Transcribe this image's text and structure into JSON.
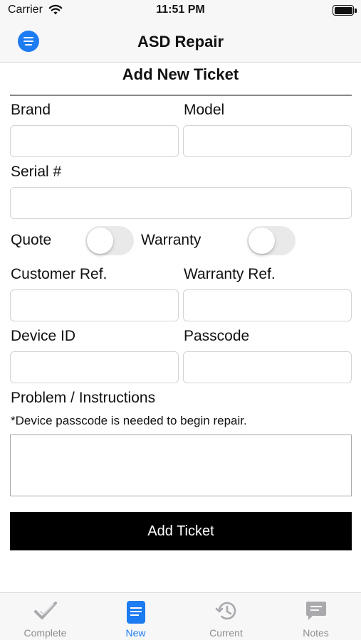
{
  "status_bar": {
    "carrier": "Carrier",
    "time": "11:51 PM"
  },
  "nav": {
    "title": "ASD Repair",
    "menu_icon": "menu-lines-icon"
  },
  "form": {
    "heading": "Add New Ticket",
    "brand_label": "Brand",
    "model_label": "Model",
    "serial_label": "Serial #",
    "quote_label": "Quote",
    "warranty_label": "Warranty",
    "quote_on": false,
    "warranty_on": false,
    "customer_ref_label": "Customer Ref.",
    "warranty_ref_label": "Warranty Ref.",
    "device_id_label": "Device ID",
    "passcode_label": "Passcode",
    "problem_label": "Problem / Instructions",
    "passcode_note": "*Device passcode is needed to begin repair.",
    "fields": {
      "brand": "",
      "model": "",
      "serial": "",
      "customer_ref": "",
      "warranty_ref": "",
      "device_id": "",
      "passcode": "",
      "problem": ""
    },
    "submit_label": "Add Ticket"
  },
  "tabs": [
    {
      "label": "Complete",
      "icon": "checkmark-icon",
      "active": false
    },
    {
      "label": "New",
      "icon": "document-icon",
      "active": true
    },
    {
      "label": "Current",
      "icon": "history-clock-icon",
      "active": false
    },
    {
      "label": "Notes",
      "icon": "chat-bubble-icon",
      "active": false
    }
  ],
  "colors": {
    "accent": "#1e7cf2",
    "inactive_tab": "#8e8e93",
    "button_bg": "#000000"
  }
}
